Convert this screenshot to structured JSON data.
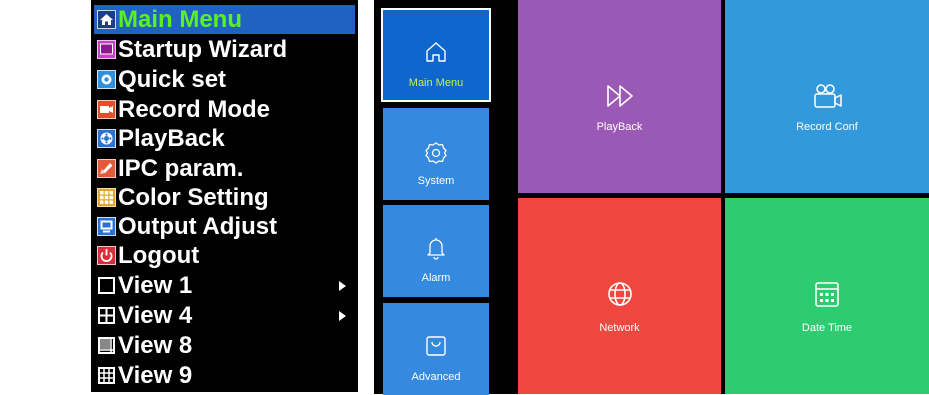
{
  "context_menu": {
    "items": [
      {
        "label": "Main Menu",
        "icon": "home-icon",
        "selected": true
      },
      {
        "label": "Startup Wizard",
        "icon": "wizard-icon"
      },
      {
        "label": "Quick set",
        "icon": "quick-set-icon"
      },
      {
        "label": "Record Mode",
        "icon": "record-icon"
      },
      {
        "label": "PlayBack",
        "icon": "playback-icon"
      },
      {
        "label": "IPC param.",
        "icon": "ipc-param-icon"
      },
      {
        "label": "Color Setting",
        "icon": "color-grid-icon"
      },
      {
        "label": "Output Adjust",
        "icon": "monitor-icon"
      },
      {
        "label": "Logout",
        "icon": "power-icon"
      },
      {
        "label": "View 1",
        "icon": "view1-icon",
        "submenu": true
      },
      {
        "label": "View 4",
        "icon": "view4-icon",
        "submenu": true
      },
      {
        "label": "View 8",
        "icon": "view8-icon"
      },
      {
        "label": "View 9",
        "icon": "view9-icon"
      }
    ]
  },
  "dvr_menu": {
    "sidebar": [
      {
        "label": "Main Menu",
        "icon": "home-icon",
        "active": true
      },
      {
        "label": "System",
        "icon": "gear-icon"
      },
      {
        "label": "Alarm",
        "icon": "bell-icon"
      },
      {
        "label": "Advanced",
        "icon": "bag-icon"
      }
    ],
    "tiles": [
      {
        "label": "PlayBack",
        "icon": "fast-forward-icon",
        "color": "#9b59b6"
      },
      {
        "label": "Record Conf",
        "icon": "video-camera-icon",
        "color": "#3399dd"
      },
      {
        "label": "Network",
        "icon": "globe-icon",
        "color": "#f0483e"
      },
      {
        "label": "Date Time",
        "icon": "calendar-icon",
        "color": "#2ecc71"
      }
    ]
  },
  "colors": {
    "selected_bg": "#1f62c1",
    "selected_text": "#5bf01f",
    "sidebar_tile": "#3589de",
    "sidebar_active": "#0f66cc"
  }
}
